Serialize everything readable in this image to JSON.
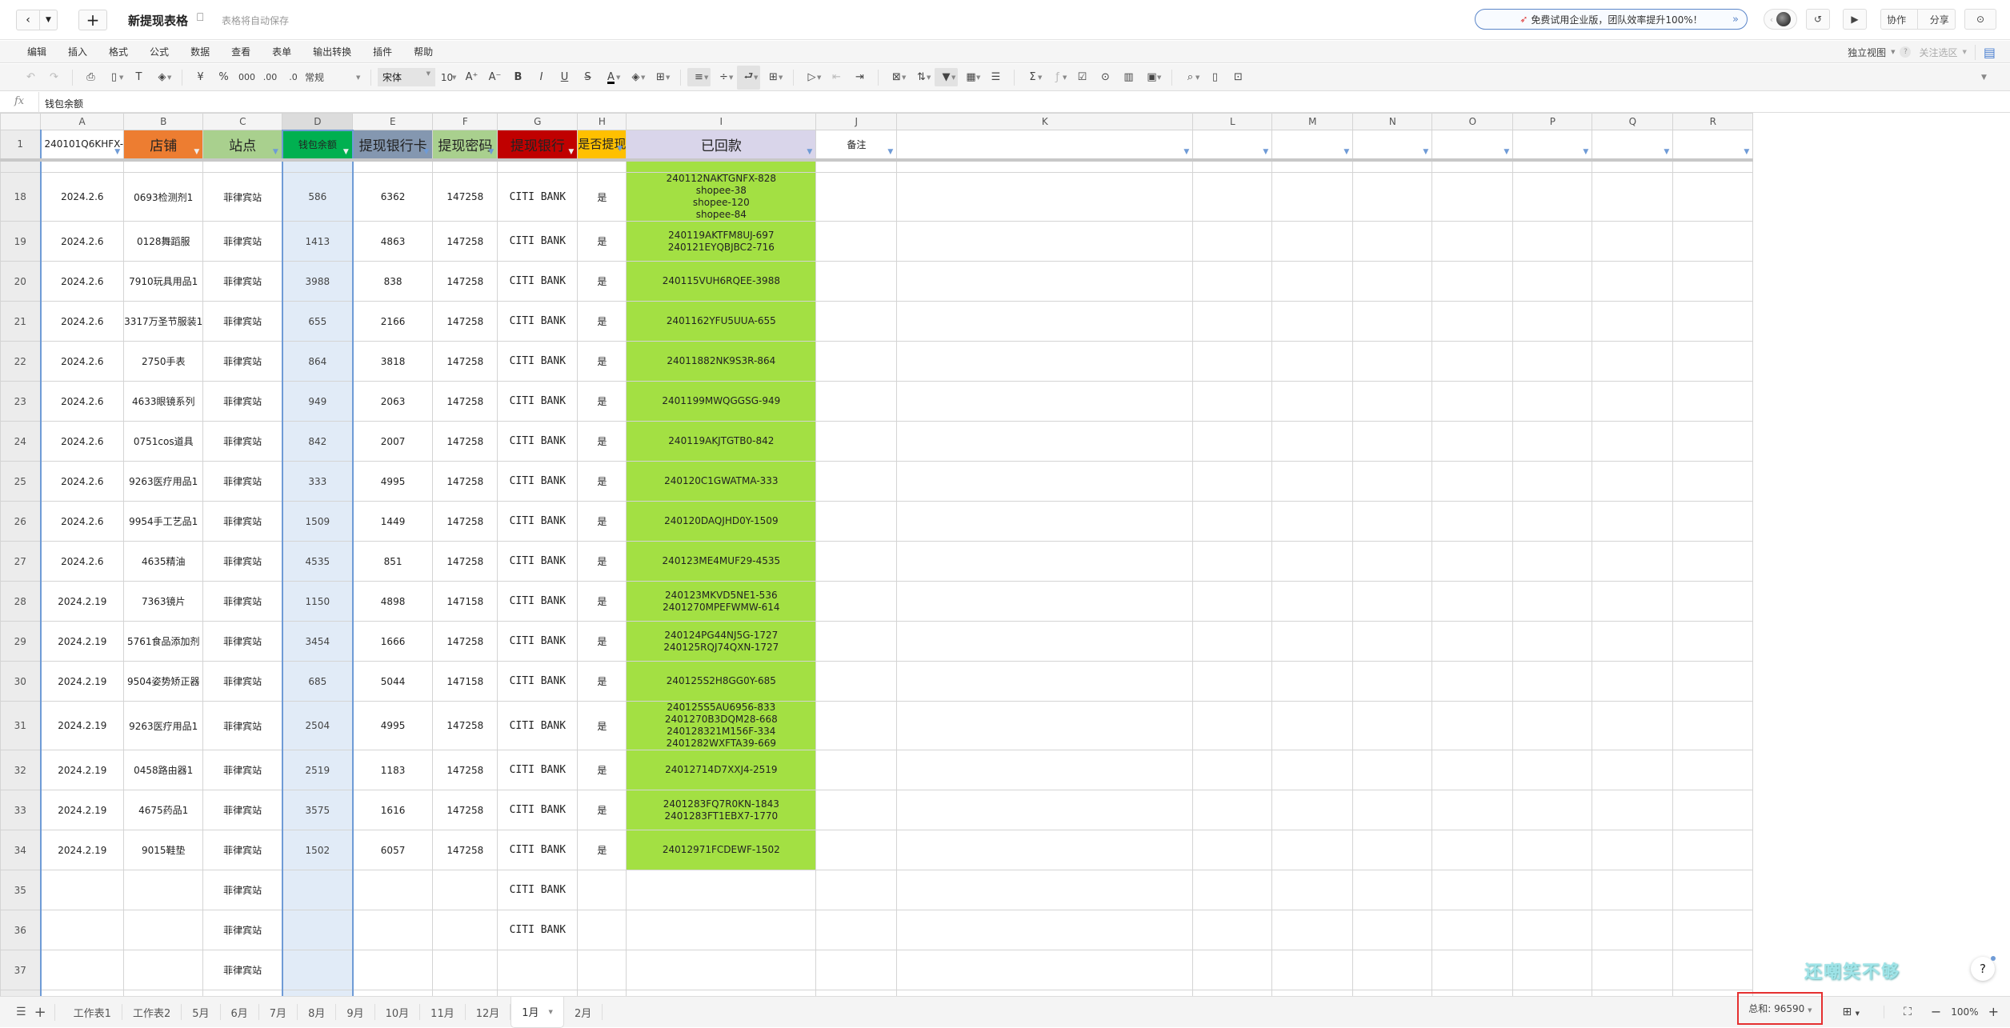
{
  "titlebar": {
    "title": "新提现表格",
    "autosave": "表格将自动保存",
    "promo": "免费试用企业版，团队效率提升100%！",
    "collab": "协作",
    "share": "分享"
  },
  "menu": {
    "items": [
      "编辑",
      "插入",
      "格式",
      "公式",
      "数据",
      "查看",
      "表单",
      "输出转换",
      "插件",
      "帮助"
    ],
    "view_mode": "独立视图",
    "focus": "关注选区"
  },
  "toolbar": {
    "currency": "¥",
    "percent": "%",
    "thousands": "000",
    "inc_decimal": ".00",
    "dec_decimal": ".0",
    "number_format": "常规",
    "font": "宋体",
    "font_size": "10"
  },
  "formula": {
    "fx": "fx",
    "value": "钱包余额"
  },
  "columns": [
    "A",
    "B",
    "C",
    "D",
    "E",
    "F",
    "G",
    "H",
    "I",
    "J",
    "K",
    "L",
    "M",
    "N",
    "O",
    "P",
    "Q",
    "R"
  ],
  "selected_column": "D",
  "header_row": {
    "num": "1",
    "cells": [
      "240101Q6KHFX-",
      "店铺",
      "站点",
      "钱包余额",
      "提现银行卡",
      "提现密码",
      "提现银行",
      "是否提现",
      "已回款",
      "备注"
    ],
    "colors": [
      "#ffffff",
      "#ED7D31",
      "#A9D08E",
      "#00B050",
      "#8497B0",
      "#A9D08E",
      "#C00000",
      "#FFC000",
      "#D9D5EA",
      "#ffffff"
    ]
  },
  "rows": [
    {
      "num": "18",
      "date": "2024.2.6",
      "shop": "0693检测剂1",
      "site": "菲律宾站",
      "balance": "586",
      "card": "6362",
      "pwd": "147258",
      "bank": "CITI BANK",
      "done": "是",
      "paid": [
        "240112NAKTGNFX-828",
        "shopee-38",
        "shopee-120",
        "shopee-84"
      ]
    },
    {
      "num": "19",
      "date": "2024.2.6",
      "shop": "0128舞蹈服",
      "site": "菲律宾站",
      "balance": "1413",
      "card": "4863",
      "pwd": "147258",
      "bank": "CITI BANK",
      "done": "是",
      "paid": [
        "240119AKTFM8UJ-697",
        "240121EYQBJBC2-716"
      ]
    },
    {
      "num": "20",
      "date": "2024.2.6",
      "shop": "7910玩具用品1",
      "site": "菲律宾站",
      "balance": "3988",
      "card": "838",
      "pwd": "147258",
      "bank": "CITI BANK",
      "done": "是",
      "paid": [
        "240115VUH6RQEE-3988"
      ]
    },
    {
      "num": "21",
      "date": "2024.2.6",
      "shop": "3317万圣节服装1",
      "site": "菲律宾站",
      "balance": "655",
      "card": "2166",
      "pwd": "147258",
      "bank": "CITI BANK",
      "done": "是",
      "paid": [
        "2401162YFU5UUA-655"
      ]
    },
    {
      "num": "22",
      "date": "2024.2.6",
      "shop": "2750手表",
      "site": "菲律宾站",
      "balance": "864",
      "card": "3818",
      "pwd": "147258",
      "bank": "CITI BANK",
      "done": "是",
      "paid": [
        "24011882NK9S3R-864"
      ]
    },
    {
      "num": "23",
      "date": "2024.2.6",
      "shop": "4633眼镜系列",
      "site": "菲律宾站",
      "balance": "949",
      "card": "2063",
      "pwd": "147258",
      "bank": "CITI BANK",
      "done": "是",
      "paid": [
        "2401199MWQGGSG-949"
      ]
    },
    {
      "num": "24",
      "date": "2024.2.6",
      "shop": "0751cos道具",
      "site": "菲律宾站",
      "balance": "842",
      "card": "2007",
      "pwd": "147258",
      "bank": "CITI BANK",
      "done": "是",
      "paid": [
        "240119AKJTGTB0-842"
      ]
    },
    {
      "num": "25",
      "date": "2024.2.6",
      "shop": "9263医疗用品1",
      "site": "菲律宾站",
      "balance": "333",
      "card": "4995",
      "pwd": "147258",
      "bank": "CITI BANK",
      "done": "是",
      "paid": [
        "240120C1GWATMA-333"
      ]
    },
    {
      "num": "26",
      "date": "2024.2.6",
      "shop": "9954手工艺品1",
      "site": "菲律宾站",
      "balance": "1509",
      "card": "1449",
      "pwd": "147258",
      "bank": "CITI BANK",
      "done": "是",
      "paid": [
        "240120DAQJHD0Y-1509"
      ]
    },
    {
      "num": "27",
      "date": "2024.2.6",
      "shop": "4635精油",
      "site": "菲律宾站",
      "balance": "4535",
      "card": "851",
      "pwd": "147258",
      "bank": "CITI BANK",
      "done": "是",
      "paid": [
        "240123ME4MUF29-4535"
      ]
    },
    {
      "num": "28",
      "date": "2024.2.19",
      "shop": "7363镜片",
      "site": "菲律宾站",
      "balance": "1150",
      "card": "4898",
      "pwd": "147158",
      "bank": "CITI BANK",
      "done": "是",
      "paid": [
        "240123MKVD5NE1-536",
        "2401270MPEFWMW-614"
      ]
    },
    {
      "num": "29",
      "date": "2024.2.19",
      "shop": "5761食品添加剂",
      "site": "菲律宾站",
      "balance": "3454",
      "card": "1666",
      "pwd": "147258",
      "bank": "CITI BANK",
      "done": "是",
      "paid": [
        "240124PG44NJ5G-1727",
        "240125RQJ74QXN-1727"
      ]
    },
    {
      "num": "30",
      "date": "2024.2.19",
      "shop": "9504姿势矫正器",
      "site": "菲律宾站",
      "balance": "685",
      "card": "5044",
      "pwd": "147158",
      "bank": "CITI BANK",
      "done": "是",
      "paid": [
        "240125S2H8GG0Y-685"
      ]
    },
    {
      "num": "31",
      "date": "2024.2.19",
      "shop": "9263医疗用品1",
      "site": "菲律宾站",
      "balance": "2504",
      "card": "4995",
      "pwd": "147258",
      "bank": "CITI BANK",
      "done": "是",
      "paid": [
        "240125S5AU6956-833",
        "2401270B3DQM28-668",
        "240128321M156F-334",
        "2401282WXFTA39-669"
      ]
    },
    {
      "num": "32",
      "date": "2024.2.19",
      "shop": "0458路由器1",
      "site": "菲律宾站",
      "balance": "2519",
      "card": "1183",
      "pwd": "147258",
      "bank": "CITI BANK",
      "done": "是",
      "paid": [
        "24012714D7XXJ4-2519"
      ]
    },
    {
      "num": "33",
      "date": "2024.2.19",
      "shop": "4675药品1",
      "site": "菲律宾站",
      "balance": "3575",
      "card": "1616",
      "pwd": "147258",
      "bank": "CITI BANK",
      "done": "是",
      "paid": [
        "2401283FQ7R0KN-1843",
        "2401283FT1EBX7-1770"
      ]
    },
    {
      "num": "34",
      "date": "2024.2.19",
      "shop": "9015鞋垫",
      "site": "菲律宾站",
      "balance": "1502",
      "card": "6057",
      "pwd": "147258",
      "bank": "CITI BANK",
      "done": "是",
      "paid": [
        "24012971FCDEWF-1502"
      ]
    },
    {
      "num": "35",
      "date": "",
      "shop": "",
      "site": "菲律宾站",
      "balance": "",
      "card": "",
      "pwd": "",
      "bank": "CITI BANK",
      "done": "",
      "paid": []
    },
    {
      "num": "36",
      "date": "",
      "shop": "",
      "site": "菲律宾站",
      "balance": "",
      "card": "",
      "pwd": "",
      "bank": "CITI BANK",
      "done": "",
      "paid": []
    },
    {
      "num": "37",
      "date": "",
      "shop": "",
      "site": "菲律宾站",
      "balance": "",
      "card": "",
      "pwd": "",
      "bank": "",
      "done": "",
      "paid": []
    }
  ],
  "paid_color": "#A3E043",
  "sheets": [
    "工作表1",
    "工作表2",
    "5月",
    "6月",
    "7月",
    "8月",
    "9月",
    "10月",
    "11月",
    "12月",
    "1月",
    "2月"
  ],
  "active_sheet": "1月",
  "status": {
    "sum": "总和: 96590",
    "zoom": "100%"
  },
  "watermark": "还嘲笑不够",
  "help": "?"
}
